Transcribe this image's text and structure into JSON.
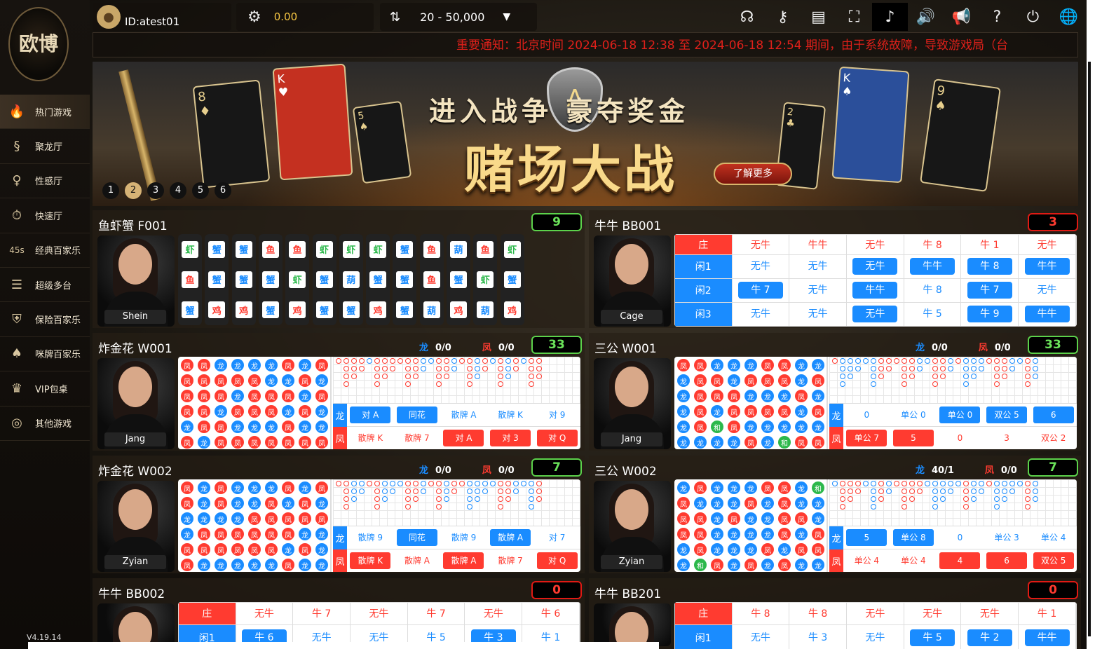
{
  "sidebar": {
    "logo_text": "欧博",
    "version": "V4.19.14",
    "items": [
      {
        "icon": "flame-icon",
        "glyph": "🔥",
        "label": "热门游戏",
        "active": true
      },
      {
        "icon": "dragon-icon",
        "glyph": "§",
        "label": "聚龙厅"
      },
      {
        "icon": "lady-icon",
        "glyph": "♀",
        "label": "性感厅"
      },
      {
        "icon": "speed-icon",
        "glyph": "⏱",
        "label": "快速厅"
      },
      {
        "icon": "45s-icon",
        "glyph": "45s",
        "label": "经典百家乐"
      },
      {
        "icon": "multi-table-icon",
        "glyph": "☰",
        "label": "超级多台"
      },
      {
        "icon": "shield-icon",
        "glyph": "⛨",
        "label": "保险百家乐"
      },
      {
        "icon": "cards-icon",
        "glyph": "♠",
        "label": "咪牌百家乐"
      },
      {
        "icon": "vip-crown-icon",
        "glyph": "♛",
        "label": "VIP包桌"
      },
      {
        "icon": "chip-icon",
        "glyph": "◎",
        "label": "其他游戏"
      }
    ]
  },
  "header": {
    "user_id": "ID:atest01",
    "balance": "0.00",
    "bet_limit": "20 - 50,000",
    "icons": [
      {
        "name": "customer-service-icon",
        "glyph": "☊"
      },
      {
        "name": "key-icon",
        "glyph": "⚷"
      },
      {
        "name": "history-icon",
        "glyph": "▤"
      },
      {
        "name": "fullscreen-icon",
        "glyph": "⛶"
      },
      {
        "name": "music-icon",
        "glyph": "♪",
        "on": true
      },
      {
        "name": "sound-icon",
        "glyph": "🔊"
      },
      {
        "name": "video-sound-icon",
        "glyph": "📢"
      },
      {
        "name": "help-icon",
        "glyph": "?"
      },
      {
        "name": "power-icon",
        "glyph": "⏻"
      },
      {
        "name": "language-globe-icon",
        "glyph": "🌐"
      }
    ]
  },
  "notice": "重要通知：北京时间 2024-06-18 12:38 至 2024-06-18 12:54 期间，由于系统故障，导致游戏局（台",
  "banner": {
    "headline": "进入战争 豪夺奖金",
    "title": "赌场大战",
    "cta": "了解更多",
    "slides": [
      "1",
      "2",
      "3",
      "4",
      "5",
      "6"
    ],
    "active_slide": 2
  },
  "colors": {
    "blue": "#1a8cff",
    "red": "#ff3b30",
    "green": "#5cd24b",
    "gold": "#d6b376"
  },
  "labels": {
    "dragon": "龙",
    "phoenix": "凤",
    "zhuang": "庄",
    "xian1": "闲1",
    "xian2": "闲2",
    "xian3": "闲3"
  },
  "tables": {
    "fxx": {
      "title": "鱼虾蟹 F001",
      "count": "9",
      "dealer": "Shein",
      "columns": [
        [
          "虾",
          "鱼",
          "蟹"
        ],
        [
          "蟹",
          "蟹",
          "鸡"
        ],
        [
          "蟹",
          "蟹",
          "鸡"
        ],
        [
          "鱼",
          "蟹",
          "蟹"
        ],
        [
          "鱼",
          "虾",
          "鸡"
        ],
        [
          "虾",
          "蟹",
          "蟹"
        ],
        [
          "虾",
          "葫",
          "蟹"
        ],
        [
          "虾",
          "蟹",
          "鸡"
        ],
        [
          "蟹",
          "蟹",
          "蟹"
        ],
        [
          "鱼",
          "鱼",
          "葫"
        ],
        [
          "葫",
          "蟹",
          "鸡"
        ],
        [
          "鱼",
          "虾",
          "葫"
        ],
        [
          "虾",
          "蟹",
          "鸡"
        ]
      ]
    },
    "bb001": {
      "title": "牛牛 BB001",
      "count": "3",
      "dealer": "Cage",
      "zhuang": [
        "无牛",
        "牛牛",
        "无牛",
        "牛 8",
        "牛 1",
        "无牛",
        ""
      ],
      "rows": [
        {
          "label": "闲1",
          "cells": [
            {
              "t": "无牛",
              "s": "bt"
            },
            {
              "t": "无牛",
              "s": "bt"
            },
            {
              "t": "无牛",
              "s": "b"
            },
            {
              "t": "牛牛",
              "s": "b"
            },
            {
              "t": "牛 8",
              "s": "b"
            },
            {
              "t": "牛牛",
              "s": "b"
            },
            {
              "t": "",
              "s": ""
            }
          ]
        },
        {
          "label": "闲2",
          "cells": [
            {
              "t": "牛 7",
              "s": "b"
            },
            {
              "t": "无牛",
              "s": "bt"
            },
            {
              "t": "牛牛",
              "s": "b"
            },
            {
              "t": "牛 8",
              "s": "bt"
            },
            {
              "t": "牛 7",
              "s": "b"
            },
            {
              "t": "无牛",
              "s": "bt"
            },
            {
              "t": "",
              "s": ""
            }
          ]
        },
        {
          "label": "闲3",
          "cells": [
            {
              "t": "无牛",
              "s": "bt"
            },
            {
              "t": "无牛",
              "s": "bt"
            },
            {
              "t": "无牛",
              "s": "b"
            },
            {
              "t": "牛 5",
              "s": "bt"
            },
            {
              "t": "牛 9",
              "s": "b"
            },
            {
              "t": "牛牛",
              "s": "b"
            },
            {
              "t": "",
              "s": ""
            }
          ]
        }
      ]
    },
    "w001": {
      "title": "炸金花 W001",
      "count": "33",
      "dealer": "Jang",
      "dragon": "0/0",
      "phoenix": "0/0",
      "beads": "ffffdffffffddffdffdfdfdfdfffdfddffdffdfdffdfdfdffdfddfddfff",
      "bets_dragon": [
        {
          "t": "对 A",
          "s": "b"
        },
        {
          "t": "同花",
          "s": "b"
        },
        {
          "t": "散牌 A",
          "s": "bt"
        },
        {
          "t": "散牌 K",
          "s": "bt"
        },
        {
          "t": "对 9",
          "s": "bt"
        }
      ],
      "bets_phoenix": [
        {
          "t": "散牌 K",
          "s": "rt"
        },
        {
          "t": "散牌 7",
          "s": "rt"
        },
        {
          "t": "对 A",
          "s": "r"
        },
        {
          "t": "对 3",
          "s": "r"
        },
        {
          "t": "对 Q",
          "s": "r"
        }
      ]
    },
    "sg001": {
      "title": "三公 W001",
      "count": "33",
      "dealer": "Jang",
      "dragon": "0/0",
      "phoenix": "0/0",
      "beads": "fdddddfffffddffdhdddfffddfdfdfffdfddffdfdhddfddfdfdfdfffdfddfd",
      "bets_dragon": [
        {
          "t": "0",
          "s": "bt"
        },
        {
          "t": "单公 0",
          "s": "bt"
        },
        {
          "t": "单公 0",
          "s": "b"
        },
        {
          "t": "双公 5",
          "s": "b"
        },
        {
          "t": "6",
          "s": "b"
        }
      ],
      "bets_phoenix": [
        {
          "t": "单公 7",
          "s": "r"
        },
        {
          "t": "5",
          "s": "r"
        },
        {
          "t": "0",
          "s": "rt"
        },
        {
          "t": "3",
          "s": "rt"
        },
        {
          "t": "双公 2",
          "s": "rt"
        }
      ]
    },
    "w002": {
      "title": "炸金花 W002",
      "count": "7",
      "dealer": "Zyian",
      "dragon": "0/0",
      "phoenix": "0/0",
      "beads": "ffddffdddffdffdffddddffdddfffddffffdfdffdfdffdfdfdfdddffddfddd",
      "bets_dragon": [
        {
          "t": "散牌 9",
          "s": "bt"
        },
        {
          "t": "同花",
          "s": "b"
        },
        {
          "t": "散牌 9",
          "s": "bt"
        },
        {
          "t": "散牌 A",
          "s": "b"
        },
        {
          "t": "对 7",
          "s": "bt"
        }
      ],
      "bets_phoenix": [
        {
          "t": "散牌 K",
          "s": "r"
        },
        {
          "t": "散牌 A",
          "s": "rt"
        },
        {
          "t": "散牌 A",
          "s": "r"
        },
        {
          "t": "散牌 7",
          "s": "rt"
        },
        {
          "t": "对 Q",
          "s": "r"
        }
      ]
    },
    "sg002": {
      "title": "三公 W002",
      "count": "7",
      "dealer": "Zyian",
      "dragon": "40/1",
      "phoenix": "0/0",
      "beads": "dfffddfdfffhdddddfddfddddfdddffdddfdffffdfddfdfdhddffdffdddfd",
      "bets_dragon": [
        {
          "t": "5",
          "s": "b"
        },
        {
          "t": "单公 8",
          "s": "b"
        },
        {
          "t": "0",
          "s": "bt"
        },
        {
          "t": "单公 3",
          "s": "bt"
        },
        {
          "t": "单公 4",
          "s": "bt"
        }
      ],
      "bets_phoenix": [
        {
          "t": "单公 4",
          "s": "rt"
        },
        {
          "t": "单公 4",
          "s": "rt"
        },
        {
          "t": "4",
          "s": "r"
        },
        {
          "t": "6",
          "s": "r"
        },
        {
          "t": "双公 5",
          "s": "r"
        }
      ]
    },
    "bb002": {
      "title": "牛牛 BB002",
      "count": "0",
      "zhuang": [
        "无牛",
        "牛 7",
        "无牛",
        "牛 7",
        "无牛",
        "牛 6",
        ""
      ],
      "row1": {
        "label": "闲1",
        "cells": [
          {
            "t": "牛 6",
            "s": "b"
          },
          {
            "t": "无牛",
            "s": "bt"
          },
          {
            "t": "无牛",
            "s": "bt"
          },
          {
            "t": "牛 5",
            "s": "bt"
          },
          {
            "t": "牛 3",
            "s": "b"
          },
          {
            "t": "牛 1",
            "s": "bt"
          },
          {
            "t": "",
            "s": ""
          }
        ]
      }
    },
    "bb201": {
      "title": "牛牛 BB201",
      "count": "0",
      "zhuang": [
        "牛 8",
        "牛 8",
        "无牛",
        "无牛",
        "无牛",
        "牛 1",
        ""
      ],
      "row1": {
        "label": "闲1",
        "cells": [
          {
            "t": "无牛",
            "s": "bt"
          },
          {
            "t": "牛 3",
            "s": "bt"
          },
          {
            "t": "无牛",
            "s": "bt"
          },
          {
            "t": "牛 5",
            "s": "b"
          },
          {
            "t": "牛 2",
            "s": "b"
          },
          {
            "t": "牛牛",
            "s": "b"
          },
          {
            "t": "",
            "s": ""
          }
        ]
      }
    }
  }
}
